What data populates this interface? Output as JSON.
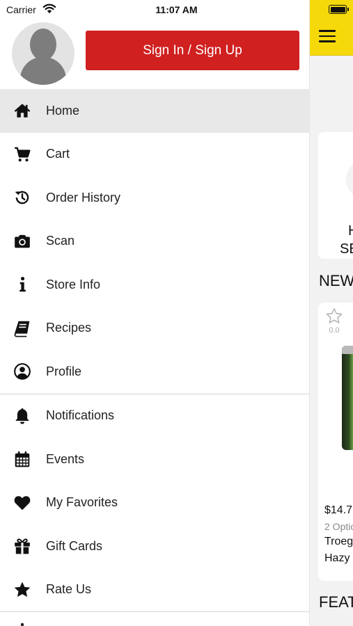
{
  "status_bar": {
    "carrier": "Carrier",
    "time": "11:07 AM"
  },
  "drawer": {
    "signin_label": "Sign In / Sign Up",
    "active_item": "Home",
    "menu_groups": [
      [
        {
          "name": "home",
          "label": "Home",
          "icon": "home-icon"
        },
        {
          "name": "cart",
          "label": "Cart",
          "icon": "cart-icon"
        },
        {
          "name": "order-history",
          "label": "Order History",
          "icon": "history-icon"
        },
        {
          "name": "scan",
          "label": "Scan",
          "icon": "camera-icon"
        },
        {
          "name": "store-info",
          "label": "Store Info",
          "icon": "info-icon"
        },
        {
          "name": "recipes",
          "label": "Recipes",
          "icon": "book-icon"
        },
        {
          "name": "profile",
          "label": "Profile",
          "icon": "user-circle-icon"
        }
      ],
      [
        {
          "name": "notifications",
          "label": "Notifications",
          "icon": "bell-icon"
        },
        {
          "name": "events",
          "label": "Events",
          "icon": "calendar-icon"
        },
        {
          "name": "my-favorites",
          "label": "My Favorites",
          "icon": "heart-icon"
        },
        {
          "name": "gift-cards",
          "label": "Gift Cards",
          "icon": "gift-icon"
        },
        {
          "name": "rate-us",
          "label": "Rate Us",
          "icon": "star-icon"
        }
      ]
    ]
  },
  "background_app": {
    "header_color": "#f5d90a",
    "card1_line1": "H",
    "card1_line2": "SE",
    "section1_title": "NEW",
    "product": {
      "rating": "0.0",
      "price": "$14.7",
      "options": "2 Optio",
      "name_line1": "Troeg",
      "name_line2": "Hazy"
    },
    "section2_title": "FEAT"
  },
  "colors": {
    "signin_button": "#d02020",
    "active_row": "#e8e8e8",
    "header_yellow": "#f5d90a"
  }
}
